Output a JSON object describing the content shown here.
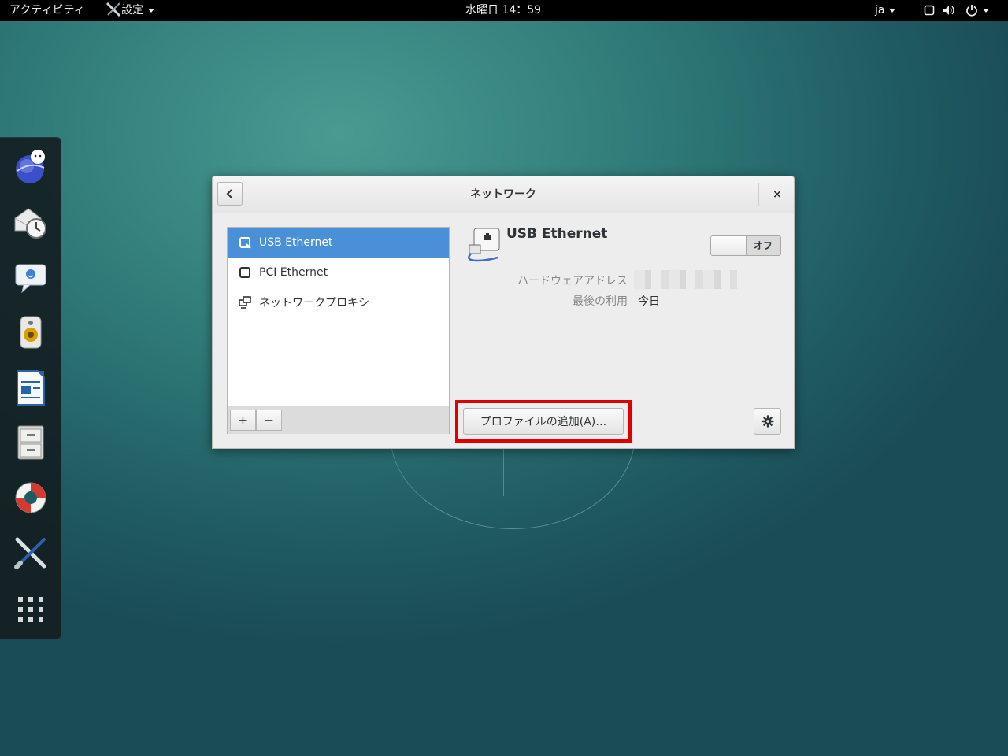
{
  "topbar": {
    "activities": "アクティビティ",
    "app_menu": "設定",
    "clock": "水曜日 14：59",
    "input_method": "ja"
  },
  "dock": {
    "items": [
      "web-browser",
      "mail-calendar",
      "chat",
      "music-player",
      "writer",
      "file-manager",
      "help",
      "settings",
      "app-grid"
    ]
  },
  "window": {
    "title": "ネットワーク",
    "close": "×",
    "devices": [
      {
        "label": "USB Ethernet",
        "selected": true
      },
      {
        "label": "PCI Ethernet",
        "selected": false
      },
      {
        "label": "ネットワークプロキシ",
        "selected": false
      }
    ],
    "add_label": "+",
    "remove_label": "−",
    "detail": {
      "device_name": "USB Ethernet",
      "toggle_state": "オフ",
      "hw_address_label": "ハードウェアアドレス",
      "last_used_label": "最後の利用",
      "last_used_value": "今日"
    },
    "add_profile_label": "プロファイルの追加(A)…"
  },
  "colors": {
    "selection": "#4a90d9",
    "highlight_box": "#e00000",
    "topbar": "#000000"
  }
}
